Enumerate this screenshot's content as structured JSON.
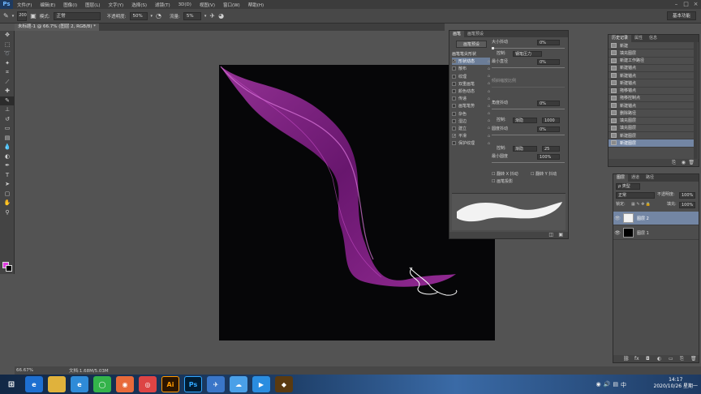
{
  "app": {
    "logo": "Ps"
  },
  "menubar": {
    "items": [
      "文件(F)",
      "编辑(E)",
      "图像(I)",
      "图层(L)",
      "文字(Y)",
      "选择(S)",
      "滤镜(T)",
      "3D(D)",
      "视图(V)",
      "窗口(W)",
      "帮助(H)"
    ]
  },
  "window_controls": {
    "minimize": "–",
    "restore": "□",
    "close": "×"
  },
  "options": {
    "brush_size": "200",
    "mode_label": "模式:",
    "mode_value": "正常",
    "opacity_label": "不透明度:",
    "opacity_value": "50%",
    "flow_label": "流量:",
    "flow_value": "5%",
    "workspace": "基本功能"
  },
  "document": {
    "tab_title": "未标题-1 @ 66.7% (图层 2, RGB/8) *",
    "zoom": "66.67%",
    "doc_size": "文档:1.68M/5.03M"
  },
  "brush_panel": {
    "tabs": [
      "画笔",
      "画笔预设"
    ],
    "preset_button": "画笔预设",
    "section_header": "画笔笔尖形状",
    "items": [
      {
        "label": "形状动态",
        "checked": true,
        "selected": true
      },
      {
        "label": "散布",
        "checked": false,
        "selected": false
      },
      {
        "label": "纹理",
        "checked": false,
        "selected": false
      },
      {
        "label": "双重画笔",
        "checked": false,
        "selected": false
      },
      {
        "label": "颜色动态",
        "checked": false,
        "selected": false
      },
      {
        "label": "传递",
        "checked": false,
        "selected": false
      },
      {
        "label": "画笔笔势",
        "checked": false,
        "selected": false
      },
      {
        "label": "杂色",
        "checked": false,
        "selected": false
      },
      {
        "label": "湿边",
        "checked": false,
        "selected": false
      },
      {
        "label": "建立",
        "checked": false,
        "selected": false
      },
      {
        "label": "平滑",
        "checked": true,
        "selected": false
      },
      {
        "label": "保护纹理",
        "checked": false,
        "selected": false
      }
    ],
    "size_jitter_label": "大小抖动",
    "size_jitter_value": "0%",
    "control_label": "控制:",
    "control_value": "钢笔压力",
    "min_diameter_label": "最小直径",
    "min_diameter_value": "0%",
    "tilt_scale_label": "倾斜缩放比例",
    "angle_jitter_label": "角度抖动",
    "angle_jitter_value": "0%",
    "angle_control_value": "渐隐",
    "angle_control_num": "1000",
    "roundness_jitter_label": "圆度抖动",
    "roundness_jitter_value": "0%",
    "roundness_control_value": "渐隐",
    "roundness_control_num": "25",
    "min_roundness_label": "最小圆度",
    "min_roundness_value": "100%",
    "flip_x": "翻转 X 抖动",
    "flip_y": "翻转 Y 抖动",
    "brush_projection": "画笔投影"
  },
  "history_panel": {
    "tabs": [
      "历史记录",
      "属性",
      "信息"
    ],
    "items": [
      {
        "label": "新建",
        "selected": false
      },
      {
        "label": "填充图层",
        "selected": false
      },
      {
        "label": "新建工作路径",
        "selected": false
      },
      {
        "label": "新建锚点",
        "selected": false
      },
      {
        "label": "新建锚点",
        "selected": false
      },
      {
        "label": "新建锚点",
        "selected": false
      },
      {
        "label": "拖移锚点",
        "selected": false
      },
      {
        "label": "拖移控制点",
        "selected": false
      },
      {
        "label": "新建锚点",
        "selected": false
      },
      {
        "label": "删除路径",
        "selected": false
      },
      {
        "label": "填充图层",
        "selected": false
      },
      {
        "label": "填充图层",
        "selected": false
      },
      {
        "label": "新建图层",
        "selected": false
      },
      {
        "label": "新建图层",
        "selected": true
      }
    ]
  },
  "layers_panel": {
    "tabs": [
      "图层",
      "通道",
      "路径"
    ],
    "kind_label": "ρ 类型",
    "blend_mode": "正常",
    "opacity_label": "不透明度:",
    "opacity_value": "100%",
    "lock_label": "锁定:",
    "fill_label": "填充:",
    "fill_value": "100%",
    "layers": [
      {
        "name": "图层 2",
        "selected": true,
        "thumb": "#f2f2f2"
      },
      {
        "name": "图层 1",
        "selected": false,
        "thumb": "#000000"
      }
    ]
  },
  "taskbar": {
    "time": "14:17",
    "date": "2020/10/26 星期一",
    "apps": [
      "Ai",
      "Ps"
    ]
  },
  "colors": {
    "foreground": "#e040e0",
    "background": "#000000",
    "accent": "#7386a4"
  }
}
